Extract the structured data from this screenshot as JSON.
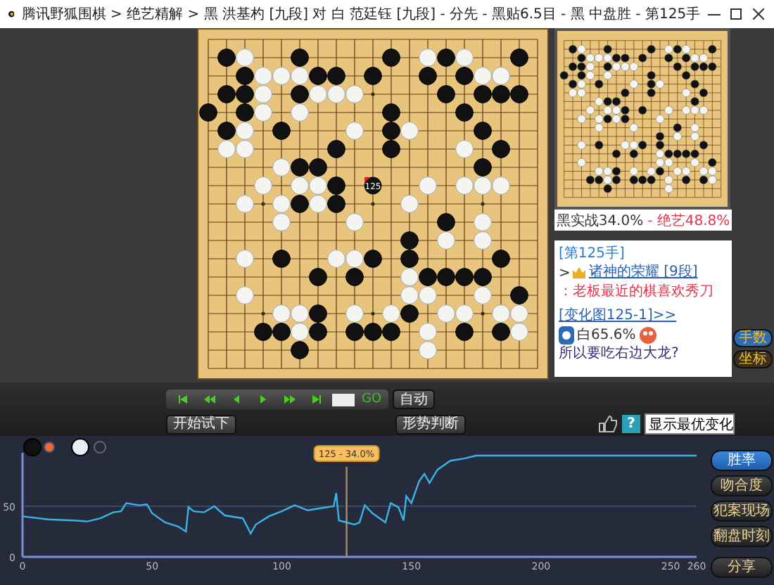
{
  "window": {
    "title": "腾讯野狐围棋 > 绝艺精解 > 黑 洪基杓 [九段] 对 白 范廷钰 [九段] - 分先 - 黑贴6.5目 - 黑 中盘胜 - 第125手"
  },
  "board": {
    "last_move_label": "125",
    "rows": [
      {
        "cells": [
          {
            "kind": "empty"
          },
          {
            "kind": "empty"
          },
          {
            "kind": "empty"
          },
          {
            "kind": "empty"
          },
          {
            "kind": "empty"
          },
          {
            "kind": "empty"
          },
          {
            "kind": "empty"
          },
          {
            "kind": "empty"
          },
          {
            "kind": "empty"
          },
          {
            "kind": "empty"
          },
          {
            "kind": "empty"
          },
          {
            "kind": "empty"
          },
          {
            "kind": "empty"
          },
          {
            "kind": "empty"
          },
          {
            "kind": "empty"
          },
          {
            "kind": "empty"
          },
          {
            "kind": "empty"
          },
          {
            "kind": "empty"
          },
          {
            "kind": "empty"
          }
        ]
      },
      {
        "cells": [
          {
            "kind": "empty"
          },
          {
            "kind": "black"
          },
          {
            "kind": "white"
          },
          {
            "kind": "empty"
          },
          {
            "kind": "empty"
          },
          {
            "kind": "black"
          },
          {
            "kind": "empty"
          },
          {
            "kind": "empty"
          },
          {
            "kind": "empty"
          },
          {
            "kind": "empty"
          },
          {
            "kind": "black"
          },
          {
            "kind": "empty"
          },
          {
            "kind": "white"
          },
          {
            "kind": "black"
          },
          {
            "kind": "white"
          },
          {
            "kind": "empty"
          },
          {
            "kind": "empty"
          },
          {
            "kind": "black"
          },
          {
            "kind": "empty"
          }
        ]
      },
      {
        "cells": [
          {
            "kind": "empty"
          },
          {
            "kind": "empty"
          },
          {
            "kind": "black"
          },
          {
            "kind": "white"
          },
          {
            "kind": "white"
          },
          {
            "kind": "white"
          },
          {
            "kind": "black"
          },
          {
            "kind": "black"
          },
          {
            "kind": "empty"
          },
          {
            "kind": "black"
          },
          {
            "kind": "empty"
          },
          {
            "kind": "empty"
          },
          {
            "kind": "black"
          },
          {
            "kind": "empty"
          },
          {
            "kind": "black"
          },
          {
            "kind": "white"
          },
          {
            "kind": "white"
          },
          {
            "kind": "empty"
          },
          {
            "kind": "empty"
          }
        ]
      },
      {
        "cells": [
          {
            "kind": "empty"
          },
          {
            "kind": "black"
          },
          {
            "kind": "black"
          },
          {
            "kind": "white"
          },
          {
            "kind": "empty"
          },
          {
            "kind": "black"
          },
          {
            "kind": "white"
          },
          {
            "kind": "white"
          },
          {
            "kind": "white"
          },
          {
            "kind": "empty"
          },
          {
            "kind": "empty"
          },
          {
            "kind": "empty"
          },
          {
            "kind": "empty"
          },
          {
            "kind": "black"
          },
          {
            "kind": "empty"
          },
          {
            "kind": "black"
          },
          {
            "kind": "black"
          },
          {
            "kind": "black"
          },
          {
            "kind": "empty"
          }
        ]
      },
      {
        "cells": [
          {
            "kind": "black"
          },
          {
            "kind": "empty"
          },
          {
            "kind": "black"
          },
          {
            "kind": "white"
          },
          {
            "kind": "empty"
          },
          {
            "kind": "white"
          },
          {
            "kind": "empty"
          },
          {
            "kind": "empty"
          },
          {
            "kind": "empty"
          },
          {
            "kind": "empty"
          },
          {
            "kind": "black"
          },
          {
            "kind": "empty"
          },
          {
            "kind": "empty"
          },
          {
            "kind": "empty"
          },
          {
            "kind": "black"
          },
          {
            "kind": "empty"
          },
          {
            "kind": "empty"
          },
          {
            "kind": "empty"
          },
          {
            "kind": "empty"
          }
        ]
      },
      {
        "cells": [
          {
            "kind": "empty"
          },
          {
            "kind": "black"
          },
          {
            "kind": "white"
          },
          {
            "kind": "empty"
          },
          {
            "kind": "black"
          },
          {
            "kind": "empty"
          },
          {
            "kind": "empty"
          },
          {
            "kind": "empty"
          },
          {
            "kind": "white"
          },
          {
            "kind": "empty"
          },
          {
            "kind": "black"
          },
          {
            "kind": "white"
          },
          {
            "kind": "empty"
          },
          {
            "kind": "empty"
          },
          {
            "kind": "empty"
          },
          {
            "kind": "black"
          },
          {
            "kind": "empty"
          },
          {
            "kind": "empty"
          },
          {
            "kind": "empty"
          }
        ]
      },
      {
        "cells": [
          {
            "kind": "empty"
          },
          {
            "kind": "white"
          },
          {
            "kind": "white"
          },
          {
            "kind": "empty"
          },
          {
            "kind": "empty"
          },
          {
            "kind": "empty"
          },
          {
            "kind": "empty"
          },
          {
            "kind": "black"
          },
          {
            "kind": "empty"
          },
          {
            "kind": "empty"
          },
          {
            "kind": "black"
          },
          {
            "kind": "empty"
          },
          {
            "kind": "empty"
          },
          {
            "kind": "empty"
          },
          {
            "kind": "white"
          },
          {
            "kind": "empty"
          },
          {
            "kind": "black"
          },
          {
            "kind": "empty"
          },
          {
            "kind": "empty"
          }
        ]
      },
      {
        "cells": [
          {
            "kind": "empty"
          },
          {
            "kind": "empty"
          },
          {
            "kind": "empty"
          },
          {
            "kind": "empty"
          },
          {
            "kind": "white"
          },
          {
            "kind": "black"
          },
          {
            "kind": "black"
          },
          {
            "kind": "empty"
          },
          {
            "kind": "empty"
          },
          {
            "kind": "empty"
          },
          {
            "kind": "empty"
          },
          {
            "kind": "empty"
          },
          {
            "kind": "empty"
          },
          {
            "kind": "empty"
          },
          {
            "kind": "empty"
          },
          {
            "kind": "black"
          },
          {
            "kind": "empty"
          },
          {
            "kind": "empty"
          },
          {
            "kind": "empty"
          }
        ]
      },
      {
        "cells": [
          {
            "kind": "empty"
          },
          {
            "kind": "empty"
          },
          {
            "kind": "empty"
          },
          {
            "kind": "white"
          },
          {
            "kind": "empty"
          },
          {
            "kind": "white"
          },
          {
            "kind": "white"
          },
          {
            "kind": "black"
          },
          {
            "kind": "empty"
          },
          {
            "kind": "last"
          },
          {
            "kind": "empty"
          },
          {
            "kind": "empty"
          },
          {
            "kind": "white"
          },
          {
            "kind": "empty"
          },
          {
            "kind": "white"
          },
          {
            "kind": "white"
          },
          {
            "kind": "white"
          },
          {
            "kind": "empty"
          },
          {
            "kind": "empty"
          }
        ]
      },
      {
        "cells": [
          {
            "kind": "empty"
          },
          {
            "kind": "empty"
          },
          {
            "kind": "white"
          },
          {
            "kind": "empty"
          },
          {
            "kind": "white"
          },
          {
            "kind": "black"
          },
          {
            "kind": "white"
          },
          {
            "kind": "black"
          },
          {
            "kind": "empty"
          },
          {
            "kind": "empty"
          },
          {
            "kind": "empty"
          },
          {
            "kind": "white"
          },
          {
            "kind": "empty"
          },
          {
            "kind": "empty"
          },
          {
            "kind": "empty"
          },
          {
            "kind": "empty"
          },
          {
            "kind": "empty"
          },
          {
            "kind": "empty"
          },
          {
            "kind": "empty"
          }
        ]
      },
      {
        "cells": [
          {
            "kind": "empty"
          },
          {
            "kind": "empty"
          },
          {
            "kind": "empty"
          },
          {
            "kind": "empty"
          },
          {
            "kind": "white"
          },
          {
            "kind": "empty"
          },
          {
            "kind": "empty"
          },
          {
            "kind": "empty"
          },
          {
            "kind": "white"
          },
          {
            "kind": "empty"
          },
          {
            "kind": "empty"
          },
          {
            "kind": "empty"
          },
          {
            "kind": "empty"
          },
          {
            "kind": "black"
          },
          {
            "kind": "empty"
          },
          {
            "kind": "white"
          },
          {
            "kind": "empty"
          },
          {
            "kind": "empty"
          },
          {
            "kind": "empty"
          }
        ]
      },
      {
        "cells": [
          {
            "kind": "empty"
          },
          {
            "kind": "empty"
          },
          {
            "kind": "empty"
          },
          {
            "kind": "empty"
          },
          {
            "kind": "empty"
          },
          {
            "kind": "empty"
          },
          {
            "kind": "empty"
          },
          {
            "kind": "empty"
          },
          {
            "kind": "empty"
          },
          {
            "kind": "empty"
          },
          {
            "kind": "empty"
          },
          {
            "kind": "black"
          },
          {
            "kind": "empty"
          },
          {
            "kind": "white"
          },
          {
            "kind": "empty"
          },
          {
            "kind": "white"
          },
          {
            "kind": "empty"
          },
          {
            "kind": "empty"
          },
          {
            "kind": "empty"
          }
        ]
      },
      {
        "cells": [
          {
            "kind": "empty"
          },
          {
            "kind": "empty"
          },
          {
            "kind": "white"
          },
          {
            "kind": "empty"
          },
          {
            "kind": "black"
          },
          {
            "kind": "empty"
          },
          {
            "kind": "empty"
          },
          {
            "kind": "white"
          },
          {
            "kind": "white"
          },
          {
            "kind": "black"
          },
          {
            "kind": "empty"
          },
          {
            "kind": "black"
          },
          {
            "kind": "empty"
          },
          {
            "kind": "empty"
          },
          {
            "kind": "empty"
          },
          {
            "kind": "empty"
          },
          {
            "kind": "black"
          },
          {
            "kind": "empty"
          },
          {
            "kind": "empty"
          }
        ]
      },
      {
        "cells": [
          {
            "kind": "empty"
          },
          {
            "kind": "empty"
          },
          {
            "kind": "empty"
          },
          {
            "kind": "empty"
          },
          {
            "kind": "empty"
          },
          {
            "kind": "empty"
          },
          {
            "kind": "black"
          },
          {
            "kind": "empty"
          },
          {
            "kind": "black"
          },
          {
            "kind": "empty"
          },
          {
            "kind": "empty"
          },
          {
            "kind": "white"
          },
          {
            "kind": "black"
          },
          {
            "kind": "black"
          },
          {
            "kind": "black"
          },
          {
            "kind": "black"
          },
          {
            "kind": "empty"
          },
          {
            "kind": "empty"
          },
          {
            "kind": "empty"
          }
        ]
      },
      {
        "cells": [
          {
            "kind": "empty"
          },
          {
            "kind": "empty"
          },
          {
            "kind": "white"
          },
          {
            "kind": "empty"
          },
          {
            "kind": "empty"
          },
          {
            "kind": "empty"
          },
          {
            "kind": "empty"
          },
          {
            "kind": "empty"
          },
          {
            "kind": "empty"
          },
          {
            "kind": "empty"
          },
          {
            "kind": "empty"
          },
          {
            "kind": "white"
          },
          {
            "kind": "white"
          },
          {
            "kind": "empty"
          },
          {
            "kind": "empty"
          },
          {
            "kind": "white"
          },
          {
            "kind": "empty"
          },
          {
            "kind": "black"
          },
          {
            "kind": "empty"
          }
        ]
      },
      {
        "cells": [
          {
            "kind": "empty"
          },
          {
            "kind": "empty"
          },
          {
            "kind": "empty"
          },
          {
            "kind": "empty"
          },
          {
            "kind": "white"
          },
          {
            "kind": "white"
          },
          {
            "kind": "black"
          },
          {
            "kind": "empty"
          },
          {
            "kind": "white"
          },
          {
            "kind": "empty"
          },
          {
            "kind": "white"
          },
          {
            "kind": "black"
          },
          {
            "kind": "empty"
          },
          {
            "kind": "white"
          },
          {
            "kind": "white"
          },
          {
            "kind": "empty"
          },
          {
            "kind": "white"
          },
          {
            "kind": "white"
          },
          {
            "kind": "empty"
          }
        ]
      },
      {
        "cells": [
          {
            "kind": "empty"
          },
          {
            "kind": "empty"
          },
          {
            "kind": "empty"
          },
          {
            "kind": "black"
          },
          {
            "kind": "black"
          },
          {
            "kind": "white"
          },
          {
            "kind": "black"
          },
          {
            "kind": "empty"
          },
          {
            "kind": "black"
          },
          {
            "kind": "black"
          },
          {
            "kind": "black"
          },
          {
            "kind": "empty"
          },
          {
            "kind": "white"
          },
          {
            "kind": "empty"
          },
          {
            "kind": "black"
          },
          {
            "kind": "empty"
          },
          {
            "kind": "black"
          },
          {
            "kind": "white"
          },
          {
            "kind": "empty"
          }
        ]
      },
      {
        "cells": [
          {
            "kind": "empty"
          },
          {
            "kind": "empty"
          },
          {
            "kind": "empty"
          },
          {
            "kind": "empty"
          },
          {
            "kind": "empty"
          },
          {
            "kind": "black"
          },
          {
            "kind": "empty"
          },
          {
            "kind": "empty"
          },
          {
            "kind": "empty"
          },
          {
            "kind": "empty"
          },
          {
            "kind": "empty"
          },
          {
            "kind": "empty"
          },
          {
            "kind": "white"
          },
          {
            "kind": "empty"
          },
          {
            "kind": "empty"
          },
          {
            "kind": "empty"
          },
          {
            "kind": "empty"
          },
          {
            "kind": "empty"
          },
          {
            "kind": "empty"
          }
        ]
      },
      {
        "cells": [
          {
            "kind": "empty"
          },
          {
            "kind": "empty"
          },
          {
            "kind": "empty"
          },
          {
            "kind": "empty"
          },
          {
            "kind": "empty"
          },
          {
            "kind": "empty"
          },
          {
            "kind": "empty"
          },
          {
            "kind": "empty"
          },
          {
            "kind": "empty"
          },
          {
            "kind": "empty"
          },
          {
            "kind": "empty"
          },
          {
            "kind": "empty"
          },
          {
            "kind": "empty"
          },
          {
            "kind": "empty"
          },
          {
            "kind": "empty"
          },
          {
            "kind": "empty"
          },
          {
            "kind": "empty"
          },
          {
            "kind": "empty"
          },
          {
            "kind": "empty"
          }
        ]
      }
    ]
  },
  "score": {
    "actual": "黑实战34.0%",
    "ai": "- 绝艺48.8%"
  },
  "comment": {
    "move_label": "[第125手]",
    "prefix": ">",
    "author": "诸神的荣耀 [9段]",
    "text": "：老板最近的棋喜欢秀刀",
    "variation_link": "[变化图125-1]>>",
    "win_rate": "白65.6%",
    "question": "所以要吃右边大龙?"
  },
  "board_buttons": [
    "手数",
    "坐标"
  ],
  "navigation": {
    "go": "GO",
    "auto": "自动"
  },
  "actions": {
    "try": "开始试下",
    "judge": "形势判断",
    "help": "?",
    "variation_select": "显示最优变化"
  },
  "chart_buttons": [
    {
      "label": "胜率",
      "selected": true
    },
    {
      "label": "吻合度",
      "selected": false
    },
    {
      "label": "犯案现场",
      "selected": false
    },
    {
      "label": "翻盘时刻",
      "selected": false
    }
  ],
  "share": "分享",
  "chart_data": {
    "type": "line",
    "xlim": [
      0,
      260
    ],
    "ylim": [
      0,
      100
    ],
    "xticks": [
      0,
      50,
      100,
      150,
      200,
      250,
      260
    ],
    "yticks": [
      0,
      50
    ],
    "x": [
      0,
      10,
      20,
      25,
      30,
      35,
      38,
      40,
      45,
      48,
      50,
      55,
      60,
      63,
      64,
      66,
      70,
      74,
      78,
      85,
      88,
      90,
      95,
      100,
      105,
      110,
      115,
      120,
      121,
      122,
      125,
      128,
      130,
      132,
      135,
      140,
      142,
      145,
      147,
      148,
      150,
      153,
      155,
      157,
      160,
      165,
      170,
      175,
      200,
      230,
      260
    ],
    "series": [
      {
        "color": "#3ab4e8",
        "values": [
          40,
          37,
          36,
          35,
          38,
          44,
          45,
          53,
          51,
          52,
          43,
          34,
          30,
          25,
          49,
          45,
          44,
          50,
          41,
          38,
          23,
          32,
          40,
          45,
          51,
          46,
          48,
          50,
          63,
          36,
          34,
          32,
          34,
          51,
          43,
          34,
          53,
          49,
          36,
          60,
          53,
          75,
          82,
          73,
          86,
          95,
          97,
          100,
          100,
          100,
          100
        ]
      }
    ],
    "ref_lines": [
      {
        "axis": "y",
        "value": 50
      },
      {
        "axis": "x",
        "value": 125
      }
    ],
    "annotations": [
      {
        "text": "125 - 34.0%"
      }
    ]
  }
}
